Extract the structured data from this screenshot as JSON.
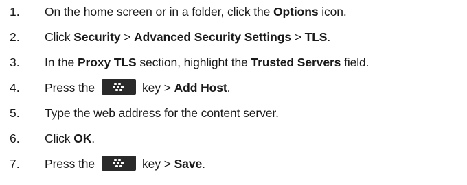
{
  "steps": [
    {
      "number": "1.",
      "parts": [
        "On the home screen or in a folder, click the ",
        "Options",
        " icon."
      ]
    },
    {
      "number": "2.",
      "parts": [
        "Click ",
        "Security",
        " > ",
        "Advanced Security Settings",
        " > ",
        "TLS",
        "."
      ]
    },
    {
      "number": "3.",
      "parts": [
        "In the ",
        "Proxy TLS",
        " section, highlight the ",
        "Trusted Servers",
        " field."
      ]
    },
    {
      "number": "4.",
      "before_key": "Press the",
      "key_icon": "blackberry-menu-key-icon",
      "after_key": [
        "key > ",
        "Add Host",
        "."
      ]
    },
    {
      "number": "5.",
      "text": "Type the web address for the content server."
    },
    {
      "number": "6.",
      "parts": [
        "Click ",
        "OK",
        "."
      ]
    },
    {
      "number": "7.",
      "before_key": "Press the",
      "key_icon": "blackberry-menu-key-icon",
      "after_key": [
        "key > ",
        "Save",
        "."
      ]
    }
  ],
  "colors": {
    "text": "#1a1a1a",
    "key_background": "#2a2a2a",
    "key_symbol": "#ffffff"
  }
}
